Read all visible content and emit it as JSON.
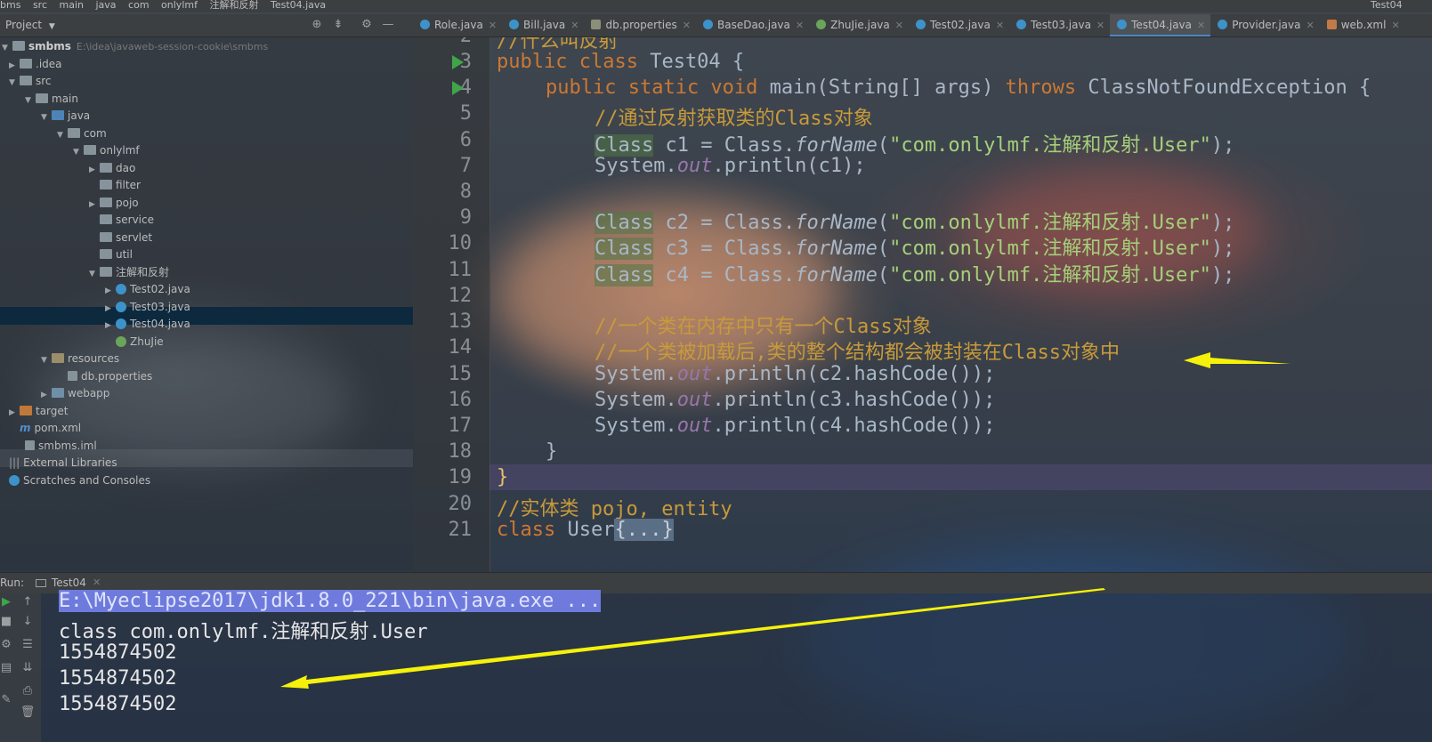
{
  "breadcrumb": [
    "bms",
    "src",
    "main",
    "java",
    "com",
    "onlylmf",
    "注解和反射",
    "Test04.java"
  ],
  "run_config": "Test04",
  "project_panel": {
    "title": "Project",
    "icons": [
      "target-icon",
      "collapse-icon",
      "gear-icon",
      "minimize-icon"
    ]
  },
  "tabs": [
    {
      "label": "Role.java",
      "active": false
    },
    {
      "label": "Bill.java",
      "active": false
    },
    {
      "label": "db.properties",
      "active": false
    },
    {
      "label": "BaseDao.java",
      "active": false
    },
    {
      "label": "ZhuJie.java",
      "active": false
    },
    {
      "label": "Test02.java",
      "active": false
    },
    {
      "label": "Test03.java",
      "active": false
    },
    {
      "label": "Test04.java",
      "active": true
    },
    {
      "label": "Provider.java",
      "active": false
    },
    {
      "label": "web.xml",
      "active": false
    }
  ],
  "tree": {
    "root_name": "smbms",
    "root_path": "E:\\idea\\javaweb-session-cookie\\smbms",
    "items": [
      {
        "label": ".idea"
      },
      {
        "label": "src"
      },
      {
        "label": "main"
      },
      {
        "label": "java"
      },
      {
        "label": "com"
      },
      {
        "label": "onlylmf"
      },
      {
        "label": "dao"
      },
      {
        "label": "filter"
      },
      {
        "label": "pojo"
      },
      {
        "label": "service"
      },
      {
        "label": "servlet"
      },
      {
        "label": "util"
      },
      {
        "label": "注解和反射"
      },
      {
        "label": "Test02.java"
      },
      {
        "label": "Test03.java"
      },
      {
        "label": "Test04.java"
      },
      {
        "label": "ZhuJie"
      },
      {
        "label": "resources"
      },
      {
        "label": "db.properties"
      },
      {
        "label": "webapp"
      },
      {
        "label": "target"
      },
      {
        "label": "pom.xml"
      },
      {
        "label": "smbms.iml"
      },
      {
        "label": "External Libraries"
      },
      {
        "label": "Scratches and Consoles"
      }
    ]
  },
  "editor": {
    "line_numbers": [
      "2",
      "3",
      "4",
      "5",
      "6",
      "7",
      "8",
      "9",
      "10",
      "11",
      "12",
      "13",
      "14",
      "15",
      "16",
      "17",
      "18",
      "19",
      "20",
      "21"
    ],
    "top_partial_comment": "//什么叫反射",
    "l3": {
      "kw": "public class",
      "name": "Test04 {"
    },
    "l4": {
      "kw1": "public static void",
      "sig": "main(String[] args)",
      "kw2": "throws",
      "exc": "ClassNotFoundException {"
    },
    "l5": "//通过反射获取类的Class对象",
    "decl": [
      {
        "type": "Class",
        "var": "c1",
        "call": "forName",
        "arg": "\"com.onlylmf.注解和反射.User\""
      },
      {
        "type": "Class",
        "var": "c2",
        "call": "forName",
        "arg": "\"com.onlylmf.注解和反射.User\""
      },
      {
        "type": "Class",
        "var": "c3",
        "call": "forName",
        "arg": "\"com.onlylmf.注解和反射.User\""
      },
      {
        "type": "Class",
        "var": "c4",
        "call": "forName",
        "arg": "\"com.onlylmf.注解和反射.User\""
      }
    ],
    "l7": {
      "obj": "System.",
      "field": "out",
      "rest": ".println(c1);"
    },
    "l13": "//一个类在内存中只有一个Class对象",
    "l14": "//一个类被加载后,类的整个结构都会被封装在Class对象中",
    "prints": [
      {
        "obj": "System.",
        "field": "out",
        "rest": ".println(c2.hashCode());"
      },
      {
        "obj": "System.",
        "field": "out",
        "rest": ".println(c3.hashCode());"
      },
      {
        "obj": "System.",
        "field": "out",
        "rest": ".println(c4.hashCode());"
      }
    ],
    "l18": "}",
    "l19": "}",
    "l20": "//实体类 pojo, entity",
    "l21": {
      "kw": "class",
      "name": "User",
      "folded": "{...}"
    }
  },
  "run_panel": {
    "label": "Run:",
    "tab": "Test04",
    "console": [
      "E:\\Myeclipse2017\\jdk1.8.0_221\\bin\\java.exe ...",
      "class com.onlylmf.注解和反射.User",
      "1554874502",
      "1554874502",
      "1554874502"
    ]
  },
  "colors": {
    "keyword": "#cc7832",
    "comment": "#c89a3a",
    "string": "#a5d07a",
    "field": "#9876aa",
    "arrow": "#f5f10a",
    "selection": "#0d293e"
  }
}
